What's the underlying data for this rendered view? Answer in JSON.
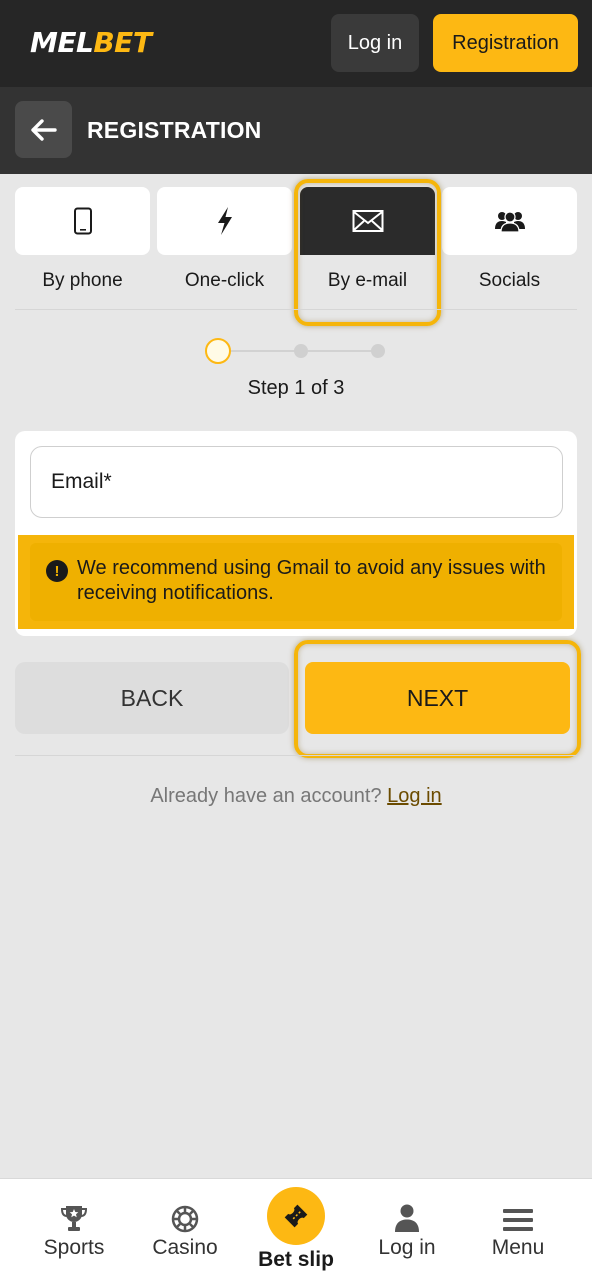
{
  "header": {
    "logo_part1": "MEL",
    "logo_part2": "BET",
    "login_label": "Log in",
    "registration_label": "Registration"
  },
  "title_bar": {
    "back_icon": "arrow-left-icon",
    "title": "REGISTRATION"
  },
  "methods": [
    {
      "label": "By phone",
      "icon": "phone-icon",
      "active": false
    },
    {
      "label": "One-click",
      "icon": "lightning-icon",
      "active": false
    },
    {
      "label": "By e-mail",
      "icon": "envelope-icon",
      "active": true
    },
    {
      "label": "Socials",
      "icon": "people-icon",
      "active": false
    }
  ],
  "steps": {
    "current": 1,
    "total": 3,
    "text": "Step 1 of 3"
  },
  "form": {
    "email_placeholder": "Email*",
    "email_value": "",
    "warning": "We recommend using Gmail to avoid any issues with receiving notifications."
  },
  "actions": {
    "back_label": "BACK",
    "next_label": "NEXT"
  },
  "footer_prompt": {
    "text": "Already have an account?",
    "link": "Log in"
  },
  "bottom_nav": {
    "sports": "Sports",
    "casino": "Casino",
    "bet_slip": "Bet slip",
    "login": "Log in",
    "menu": "Menu"
  },
  "colors": {
    "accent": "#fdb813",
    "header_bg": "#262626",
    "title_bg": "#333333",
    "page_bg": "#e7e7e7"
  }
}
